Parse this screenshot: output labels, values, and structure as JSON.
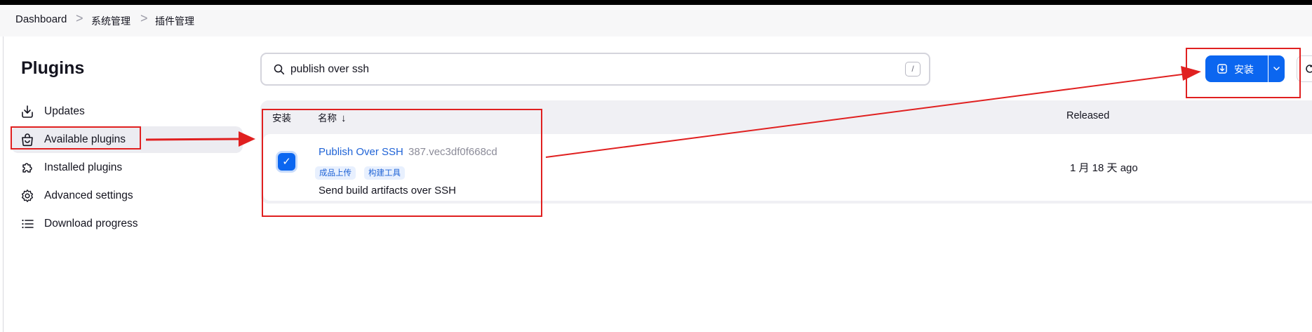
{
  "breadcrumb": {
    "items": [
      "Dashboard",
      "系统管理",
      "插件管理"
    ],
    "separator": ">"
  },
  "page": {
    "title": "Plugins"
  },
  "sidebar": {
    "items": [
      {
        "label": "Updates",
        "icon": "download-icon",
        "active": false
      },
      {
        "label": "Available plugins",
        "icon": "shopping-bag-icon",
        "active": true
      },
      {
        "label": "Installed plugins",
        "icon": "puzzle-icon",
        "active": false
      },
      {
        "label": "Advanced settings",
        "icon": "gear-icon",
        "active": false
      },
      {
        "label": "Download progress",
        "icon": "list-icon",
        "active": false
      }
    ]
  },
  "search": {
    "value": "publish over ssh",
    "shortcut": "/"
  },
  "toolbar": {
    "install_label": "安装",
    "accent": "#0b66f0"
  },
  "table": {
    "columns": {
      "install": "安装",
      "name": "名称",
      "sort_indicator": "↓",
      "released": "Released"
    },
    "rows": [
      {
        "checked": true,
        "name": "Publish Over SSH",
        "version": "387.vec3df0f668cd",
        "tags": [
          "成品上传",
          "构建工具"
        ],
        "description": "Send build artifacts over SSH",
        "released": "1 月 18 天 ago"
      }
    ]
  },
  "annotation_color": "#e02020"
}
